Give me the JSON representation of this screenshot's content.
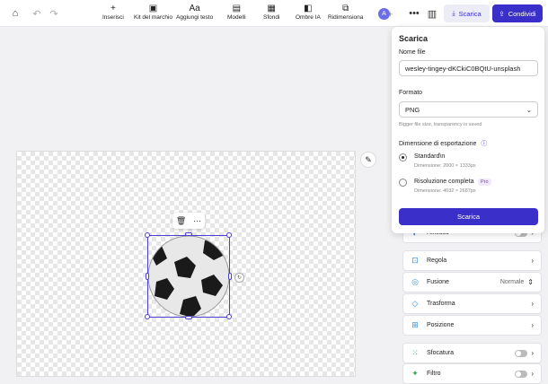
{
  "toolbar": {
    "tools": [
      "Inserisci",
      "Kit del marchio",
      "Aggiungi testo",
      "Modelli",
      "Sfondi",
      "Ombre IA",
      "Ridimensiona"
    ],
    "avatar_letter": "A",
    "scarica_label": "Scarica",
    "condividi_label": "Condividi"
  },
  "download_panel": {
    "title": "Scarica",
    "filename_label": "Nome file",
    "filename_value": "wesley-tingey-dKCkiC0BQtU-unsplash",
    "format_label": "Formato",
    "format_value": "PNG",
    "format_hint": "Bigger file size, transparency is saved",
    "dimension_label": "Dimensione di esportazione",
    "options": [
      {
        "label": "Standard\\n",
        "sub": "Dimensione: 2000 × 1333px",
        "selected": true
      },
      {
        "label": "Risoluzione completa",
        "sub": "Dimensione: 4032 × 2687px",
        "badge": "Pro",
        "selected": false
      }
    ],
    "download_button": "Scarica"
  },
  "adjust_panel": {
    "rows": [
      {
        "label": "Riflesso",
        "control": "toggle"
      },
      {
        "label": "Regola",
        "control": "chevron"
      },
      {
        "label": "Fusione",
        "control": "select",
        "value": "Normale"
      },
      {
        "label": "Trasforma",
        "control": "chevron"
      },
      {
        "label": "Posizione",
        "control": "chevron"
      },
      {
        "label": "Sfocatura",
        "control": "toggle"
      },
      {
        "label": "Filtro",
        "control": "toggle"
      }
    ]
  },
  "colors": {
    "accent": "#3b2fc9",
    "selection": "#4b3fd0"
  }
}
